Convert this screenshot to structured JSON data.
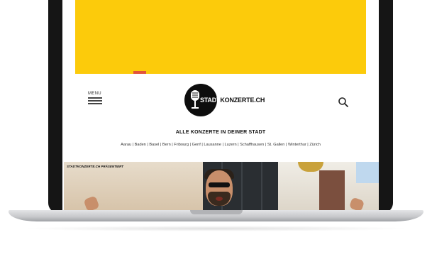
{
  "header": {
    "menu_label": "MENU",
    "logo": {
      "text_part1": "STADT",
      "text_part2": "KONZERTE.CH"
    }
  },
  "main": {
    "headline": "ALLE KONZERTE IN DEINER STADT",
    "cities": "Aarau | Baden | Basel | Bern | Fribourg | Genf | Lausanne | Luzern | Schaffhausen | St. Gallen | Winterthur | Zürich"
  },
  "feature": {
    "caption": "STADTKONZERTE.CH PRÄSENTIERT"
  },
  "colors": {
    "banner": "#fccb0b",
    "logo_circle": "#0d0d0d"
  }
}
